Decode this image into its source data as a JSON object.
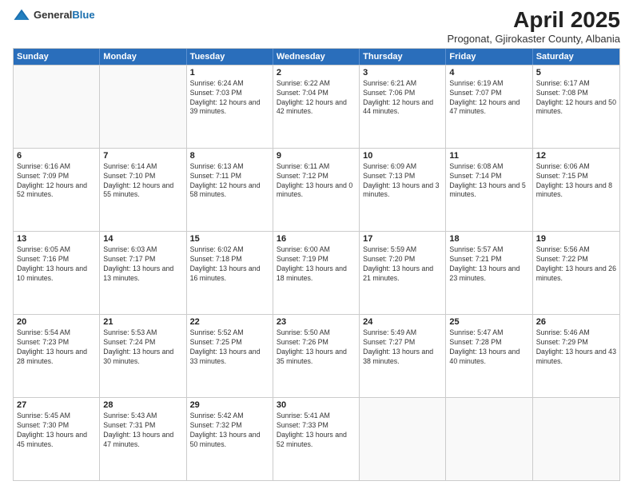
{
  "header": {
    "logo_general": "General",
    "logo_blue": "Blue",
    "title": "April 2025",
    "location": "Progonat, Gjirokaster County, Albania"
  },
  "weekdays": [
    "Sunday",
    "Monday",
    "Tuesday",
    "Wednesday",
    "Thursday",
    "Friday",
    "Saturday"
  ],
  "weeks": [
    [
      {
        "day": "",
        "sunrise": "",
        "sunset": "",
        "daylight": ""
      },
      {
        "day": "",
        "sunrise": "",
        "sunset": "",
        "daylight": ""
      },
      {
        "day": "1",
        "sunrise": "Sunrise: 6:24 AM",
        "sunset": "Sunset: 7:03 PM",
        "daylight": "Daylight: 12 hours and 39 minutes."
      },
      {
        "day": "2",
        "sunrise": "Sunrise: 6:22 AM",
        "sunset": "Sunset: 7:04 PM",
        "daylight": "Daylight: 12 hours and 42 minutes."
      },
      {
        "day": "3",
        "sunrise": "Sunrise: 6:21 AM",
        "sunset": "Sunset: 7:06 PM",
        "daylight": "Daylight: 12 hours and 44 minutes."
      },
      {
        "day": "4",
        "sunrise": "Sunrise: 6:19 AM",
        "sunset": "Sunset: 7:07 PM",
        "daylight": "Daylight: 12 hours and 47 minutes."
      },
      {
        "day": "5",
        "sunrise": "Sunrise: 6:17 AM",
        "sunset": "Sunset: 7:08 PM",
        "daylight": "Daylight: 12 hours and 50 minutes."
      }
    ],
    [
      {
        "day": "6",
        "sunrise": "Sunrise: 6:16 AM",
        "sunset": "Sunset: 7:09 PM",
        "daylight": "Daylight: 12 hours and 52 minutes."
      },
      {
        "day": "7",
        "sunrise": "Sunrise: 6:14 AM",
        "sunset": "Sunset: 7:10 PM",
        "daylight": "Daylight: 12 hours and 55 minutes."
      },
      {
        "day": "8",
        "sunrise": "Sunrise: 6:13 AM",
        "sunset": "Sunset: 7:11 PM",
        "daylight": "Daylight: 12 hours and 58 minutes."
      },
      {
        "day": "9",
        "sunrise": "Sunrise: 6:11 AM",
        "sunset": "Sunset: 7:12 PM",
        "daylight": "Daylight: 13 hours and 0 minutes."
      },
      {
        "day": "10",
        "sunrise": "Sunrise: 6:09 AM",
        "sunset": "Sunset: 7:13 PM",
        "daylight": "Daylight: 13 hours and 3 minutes."
      },
      {
        "day": "11",
        "sunrise": "Sunrise: 6:08 AM",
        "sunset": "Sunset: 7:14 PM",
        "daylight": "Daylight: 13 hours and 5 minutes."
      },
      {
        "day": "12",
        "sunrise": "Sunrise: 6:06 AM",
        "sunset": "Sunset: 7:15 PM",
        "daylight": "Daylight: 13 hours and 8 minutes."
      }
    ],
    [
      {
        "day": "13",
        "sunrise": "Sunrise: 6:05 AM",
        "sunset": "Sunset: 7:16 PM",
        "daylight": "Daylight: 13 hours and 10 minutes."
      },
      {
        "day": "14",
        "sunrise": "Sunrise: 6:03 AM",
        "sunset": "Sunset: 7:17 PM",
        "daylight": "Daylight: 13 hours and 13 minutes."
      },
      {
        "day": "15",
        "sunrise": "Sunrise: 6:02 AM",
        "sunset": "Sunset: 7:18 PM",
        "daylight": "Daylight: 13 hours and 16 minutes."
      },
      {
        "day": "16",
        "sunrise": "Sunrise: 6:00 AM",
        "sunset": "Sunset: 7:19 PM",
        "daylight": "Daylight: 13 hours and 18 minutes."
      },
      {
        "day": "17",
        "sunrise": "Sunrise: 5:59 AM",
        "sunset": "Sunset: 7:20 PM",
        "daylight": "Daylight: 13 hours and 21 minutes."
      },
      {
        "day": "18",
        "sunrise": "Sunrise: 5:57 AM",
        "sunset": "Sunset: 7:21 PM",
        "daylight": "Daylight: 13 hours and 23 minutes."
      },
      {
        "day": "19",
        "sunrise": "Sunrise: 5:56 AM",
        "sunset": "Sunset: 7:22 PM",
        "daylight": "Daylight: 13 hours and 26 minutes."
      }
    ],
    [
      {
        "day": "20",
        "sunrise": "Sunrise: 5:54 AM",
        "sunset": "Sunset: 7:23 PM",
        "daylight": "Daylight: 13 hours and 28 minutes."
      },
      {
        "day": "21",
        "sunrise": "Sunrise: 5:53 AM",
        "sunset": "Sunset: 7:24 PM",
        "daylight": "Daylight: 13 hours and 30 minutes."
      },
      {
        "day": "22",
        "sunrise": "Sunrise: 5:52 AM",
        "sunset": "Sunset: 7:25 PM",
        "daylight": "Daylight: 13 hours and 33 minutes."
      },
      {
        "day": "23",
        "sunrise": "Sunrise: 5:50 AM",
        "sunset": "Sunset: 7:26 PM",
        "daylight": "Daylight: 13 hours and 35 minutes."
      },
      {
        "day": "24",
        "sunrise": "Sunrise: 5:49 AM",
        "sunset": "Sunset: 7:27 PM",
        "daylight": "Daylight: 13 hours and 38 minutes."
      },
      {
        "day": "25",
        "sunrise": "Sunrise: 5:47 AM",
        "sunset": "Sunset: 7:28 PM",
        "daylight": "Daylight: 13 hours and 40 minutes."
      },
      {
        "day": "26",
        "sunrise": "Sunrise: 5:46 AM",
        "sunset": "Sunset: 7:29 PM",
        "daylight": "Daylight: 13 hours and 43 minutes."
      }
    ],
    [
      {
        "day": "27",
        "sunrise": "Sunrise: 5:45 AM",
        "sunset": "Sunset: 7:30 PM",
        "daylight": "Daylight: 13 hours and 45 minutes."
      },
      {
        "day": "28",
        "sunrise": "Sunrise: 5:43 AM",
        "sunset": "Sunset: 7:31 PM",
        "daylight": "Daylight: 13 hours and 47 minutes."
      },
      {
        "day": "29",
        "sunrise": "Sunrise: 5:42 AM",
        "sunset": "Sunset: 7:32 PM",
        "daylight": "Daylight: 13 hours and 50 minutes."
      },
      {
        "day": "30",
        "sunrise": "Sunrise: 5:41 AM",
        "sunset": "Sunset: 7:33 PM",
        "daylight": "Daylight: 13 hours and 52 minutes."
      },
      {
        "day": "",
        "sunrise": "",
        "sunset": "",
        "daylight": ""
      },
      {
        "day": "",
        "sunrise": "",
        "sunset": "",
        "daylight": ""
      },
      {
        "day": "",
        "sunrise": "",
        "sunset": "",
        "daylight": ""
      }
    ]
  ]
}
